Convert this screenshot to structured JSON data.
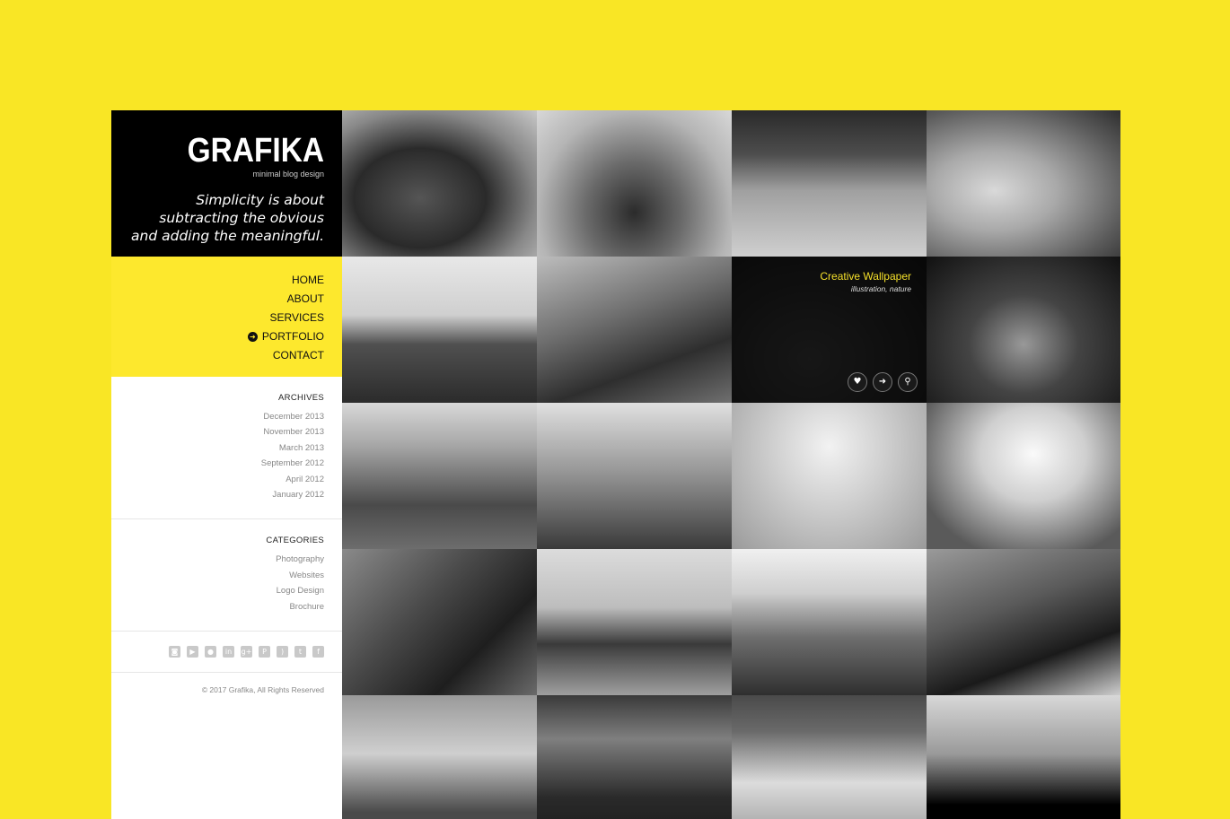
{
  "site": {
    "logo": "GRAFIKA",
    "tagline": "minimal blog design",
    "quote": "Simplicity is about subtracting the obvious and adding the meaningful."
  },
  "nav": {
    "items": [
      {
        "label": "HOME",
        "active": false
      },
      {
        "label": "ABOUT",
        "active": false
      },
      {
        "label": "SERVICES",
        "active": false
      },
      {
        "label": "PORTFOLIO",
        "active": true
      },
      {
        "label": "CONTACT",
        "active": false
      }
    ]
  },
  "archives": {
    "title": "ARCHIVES",
    "items": [
      "December 2013",
      "November 2013",
      "March 2013",
      "September 2012",
      "April 2012",
      "January 2012"
    ]
  },
  "categories": {
    "title": "CATEGORIES",
    "items": [
      "Photography",
      "Websites",
      "Logo Design",
      "Brochure"
    ]
  },
  "social": {
    "icons": [
      "instagram-icon",
      "youtube-icon",
      "flickr-icon",
      "linkedin-icon",
      "google-plus-icon",
      "pinterest-icon",
      "rss-icon",
      "twitter-icon",
      "facebook-icon"
    ],
    "glyphs": [
      "◙",
      "▶",
      "●",
      "in",
      "g+",
      "P",
      ")",
      "t",
      "f"
    ]
  },
  "footer": {
    "copyright": "© 2017 Grafika, All Rights Reserved"
  },
  "colors": {
    "background": "#f9e625",
    "accent": "#fde82d",
    "highlight_title": "#f5e02a"
  },
  "portfolio": {
    "hover_item": {
      "title": "Creative Wallpaper",
      "subtitle": "illustration, nature",
      "buttons": [
        "heart-icon",
        "arrow-right-icon",
        "search-icon"
      ]
    }
  }
}
